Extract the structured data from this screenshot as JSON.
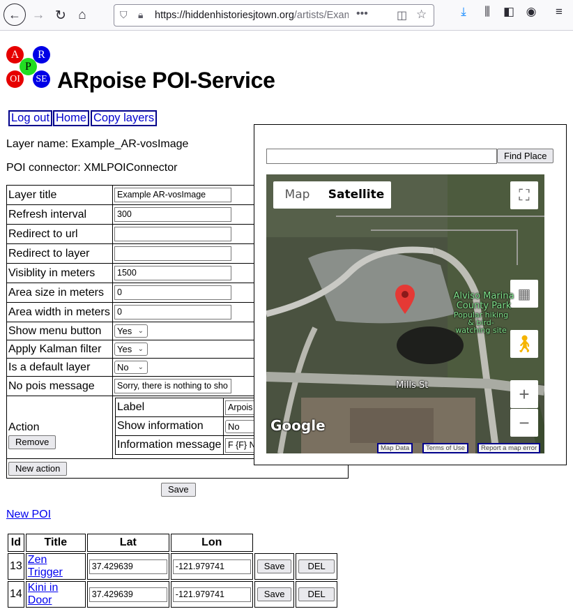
{
  "browser": {
    "url_host": "https://hiddenhistoriesjtown.org",
    "url_path": "/artists/ExampleArt"
  },
  "logo": {
    "letters": [
      "A",
      "R",
      "P",
      "OI",
      "SE"
    ]
  },
  "page": {
    "title": "ARpoise POI-Service",
    "nav": [
      "Log out",
      "Home",
      "Copy layers"
    ],
    "layer_name": "Layer name: Example_AR-vosImage",
    "poi_connector": "POI connector: XMLPOIConnector"
  },
  "layer_table": {
    "rows": [
      {
        "label": "Layer title",
        "value": "Example AR-vosImage"
      },
      {
        "label": "Refresh interval",
        "value": "300"
      },
      {
        "label": "Redirect to url",
        "value": ""
      },
      {
        "label": "Redirect to layer",
        "value": ""
      },
      {
        "label": "Visiblity in meters",
        "value": "1500"
      },
      {
        "label": "Area size in meters",
        "value": "0"
      },
      {
        "label": "Area width in meters",
        "value": "0"
      }
    ],
    "selects": [
      {
        "label": "Show menu button",
        "value": "Yes"
      },
      {
        "label": "Apply Kalman filter",
        "value": "Yes"
      },
      {
        "label": "Is a default layer",
        "value": "No"
      }
    ],
    "no_pois": {
      "label": "No pois message",
      "value": "Sorry, there is nothing to sho"
    },
    "action": {
      "label": "Action",
      "remove": "Remove",
      "fields": [
        {
          "label": "Label",
          "value": "Arpois"
        },
        {
          "label": "Show information",
          "value": "No"
        },
        {
          "label": "Information message",
          "value": "F {F} N"
        }
      ]
    },
    "new_action": "New action",
    "save": "Save"
  },
  "new_poi": "New POI",
  "poi_table": {
    "headers": [
      "Id",
      "Title",
      "Lat",
      "Lon"
    ],
    "rows": [
      {
        "id": "13",
        "title": "Zen Trigger",
        "lat": "37.429639",
        "lon": "-121.979741"
      },
      {
        "id": "14",
        "title": "Kini in Door",
        "lat": "37.429639",
        "lon": "-121.979741"
      }
    ],
    "save": "Save",
    "del": "DEL"
  },
  "map_popup": {
    "find_place_value": "",
    "find_place_button": "Find Place",
    "tabs": {
      "map": "Map",
      "satellite": "Satellite"
    },
    "labels": {
      "park": "Alviso Marina County Park",
      "popular": "Popular hiking & bird-watching site",
      "street": "Mills St"
    },
    "google": "Google",
    "footer": [
      "Map Data",
      "Terms of Use",
      "Report a map error"
    ],
    "colors": {
      "pin": "#e53935",
      "park_label": "#7ee08a"
    }
  }
}
